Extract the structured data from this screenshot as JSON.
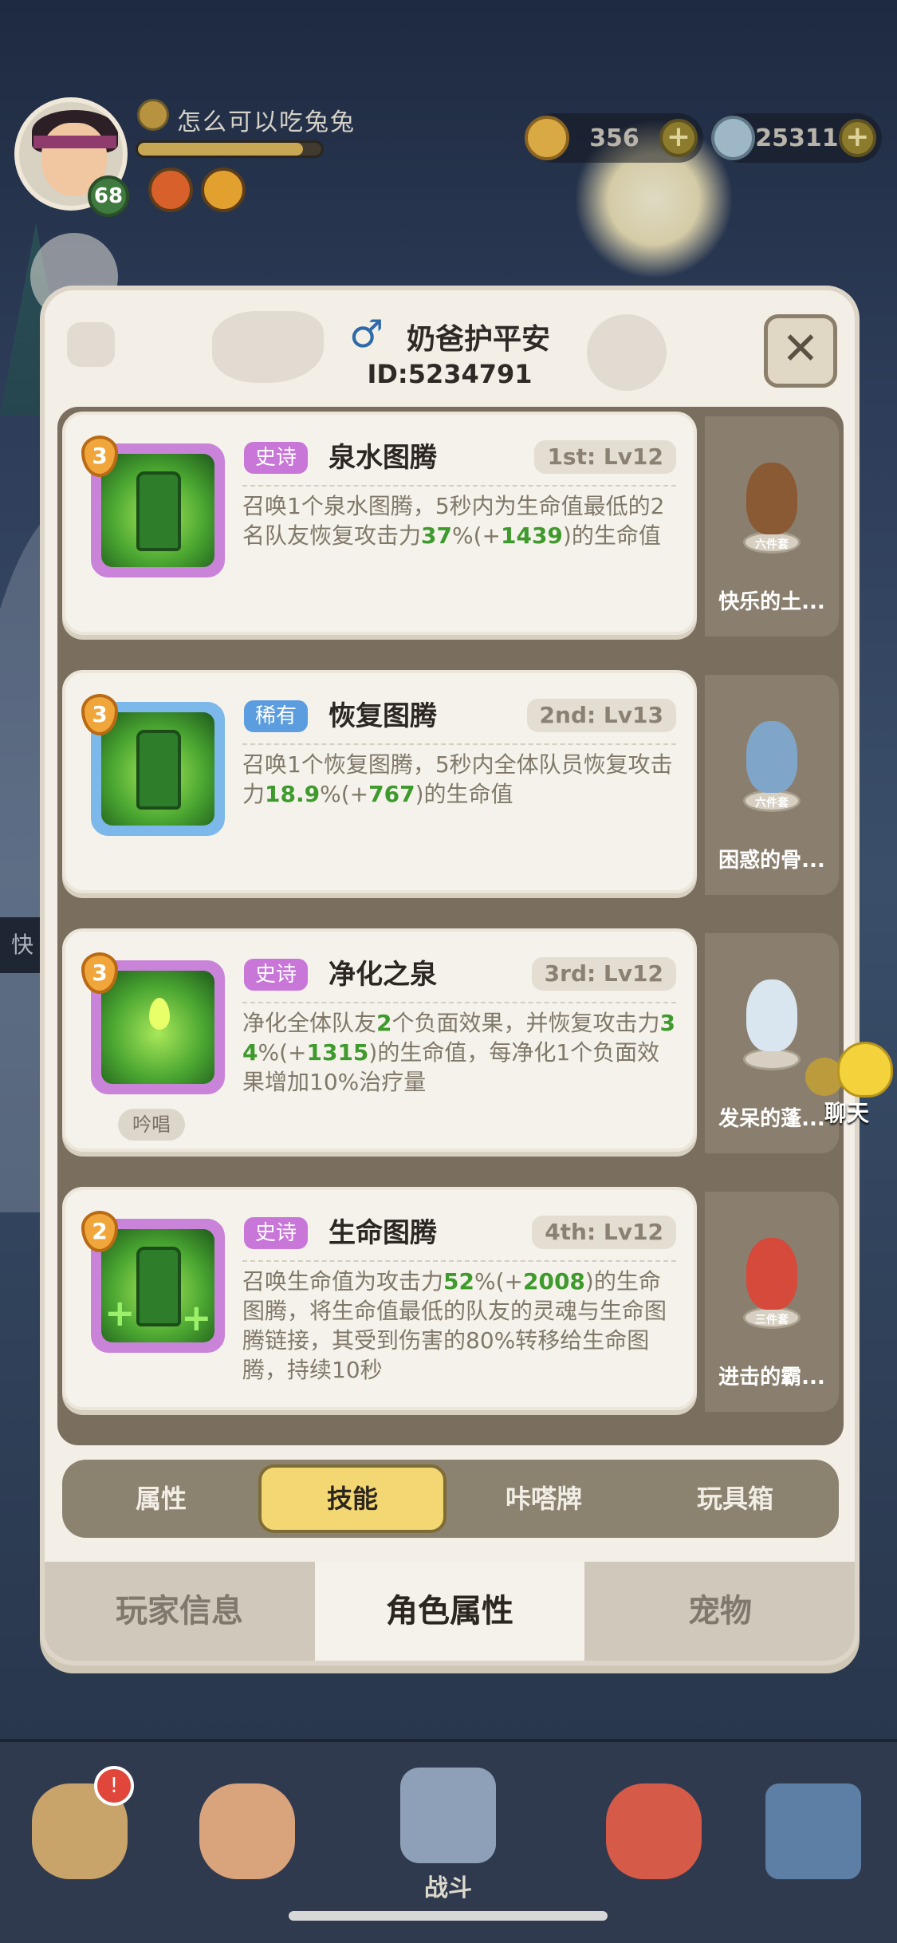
{
  "hud": {
    "player_name": "怎么可以吃兔兔",
    "level": "68",
    "xp_fraction": 0.9,
    "gold": "356",
    "gems": "25311",
    "plus": "+"
  },
  "panel": {
    "gender_icon": "male-icon",
    "title": "奶爸护平安",
    "player_id": "ID:5234791",
    "close_label": "✕"
  },
  "skills": [
    {
      "star": "3",
      "rarity": "史诗",
      "rarity_type": "epic",
      "name": "泉水图腾",
      "rank": "1st: Lv12",
      "desc_html": "召唤1个泉水图腾，5秒内为生命值最低的2名队友恢复攻击力<b>37</b>%(+<b>1439</b>)的生命值",
      "chant": ""
    },
    {
      "star": "3",
      "rarity": "稀有",
      "rarity_type": "rare",
      "name": "恢复图腾",
      "rank": "2nd: Lv13",
      "desc_html": "召唤1个恢复图腾，5秒内全体队员恢复攻击力<b>18.9</b>%(+<b>767</b>)的生命值",
      "chant": ""
    },
    {
      "star": "3",
      "rarity": "史诗",
      "rarity_type": "epic",
      "name": "净化之泉",
      "rank": "3rd: Lv12",
      "desc_html": "净化全体队友<b>2</b>个负面效果，并恢复攻击力<b>34</b>%(+<b>1315</b>)的生命值，每净化1个负面效果增加10%治疗量",
      "chant": "吟唱"
    },
    {
      "star": "2",
      "rarity": "史诗",
      "rarity_type": "epic",
      "name": "生命图腾",
      "rank": "4th: Lv12",
      "desc_html": "召唤生命值为攻击力<b>52</b>%(+<b>2008</b>)的生命图腾，将生命值最低的队友的灵魂与生命图腾链接，其受到伤害的80%转移给生命图腾，持续10秒",
      "chant": ""
    }
  ],
  "pets": [
    {
      "name": "快乐的土...",
      "set": "六件套",
      "color": "#8a5a34"
    },
    {
      "name": "困惑的骨...",
      "set": "六件套",
      "color": "#7fa6c9"
    },
    {
      "name": "发呆的蓬...",
      "set": "",
      "color": "#d9e6ef"
    },
    {
      "name": "进击的霸...",
      "set": "三件套",
      "color": "#d54a3a"
    }
  ],
  "subtabs": [
    "属性",
    "技能",
    "咔嗒牌",
    "玩具箱"
  ],
  "active_subtab": 1,
  "bottomtabs": [
    "玩家信息",
    "角色属性",
    "宠物"
  ],
  "active_bottomtab": 1,
  "chat_label": "聊天",
  "left_tab": "快",
  "nav": {
    "battle_label": "战斗",
    "notif": "!"
  }
}
